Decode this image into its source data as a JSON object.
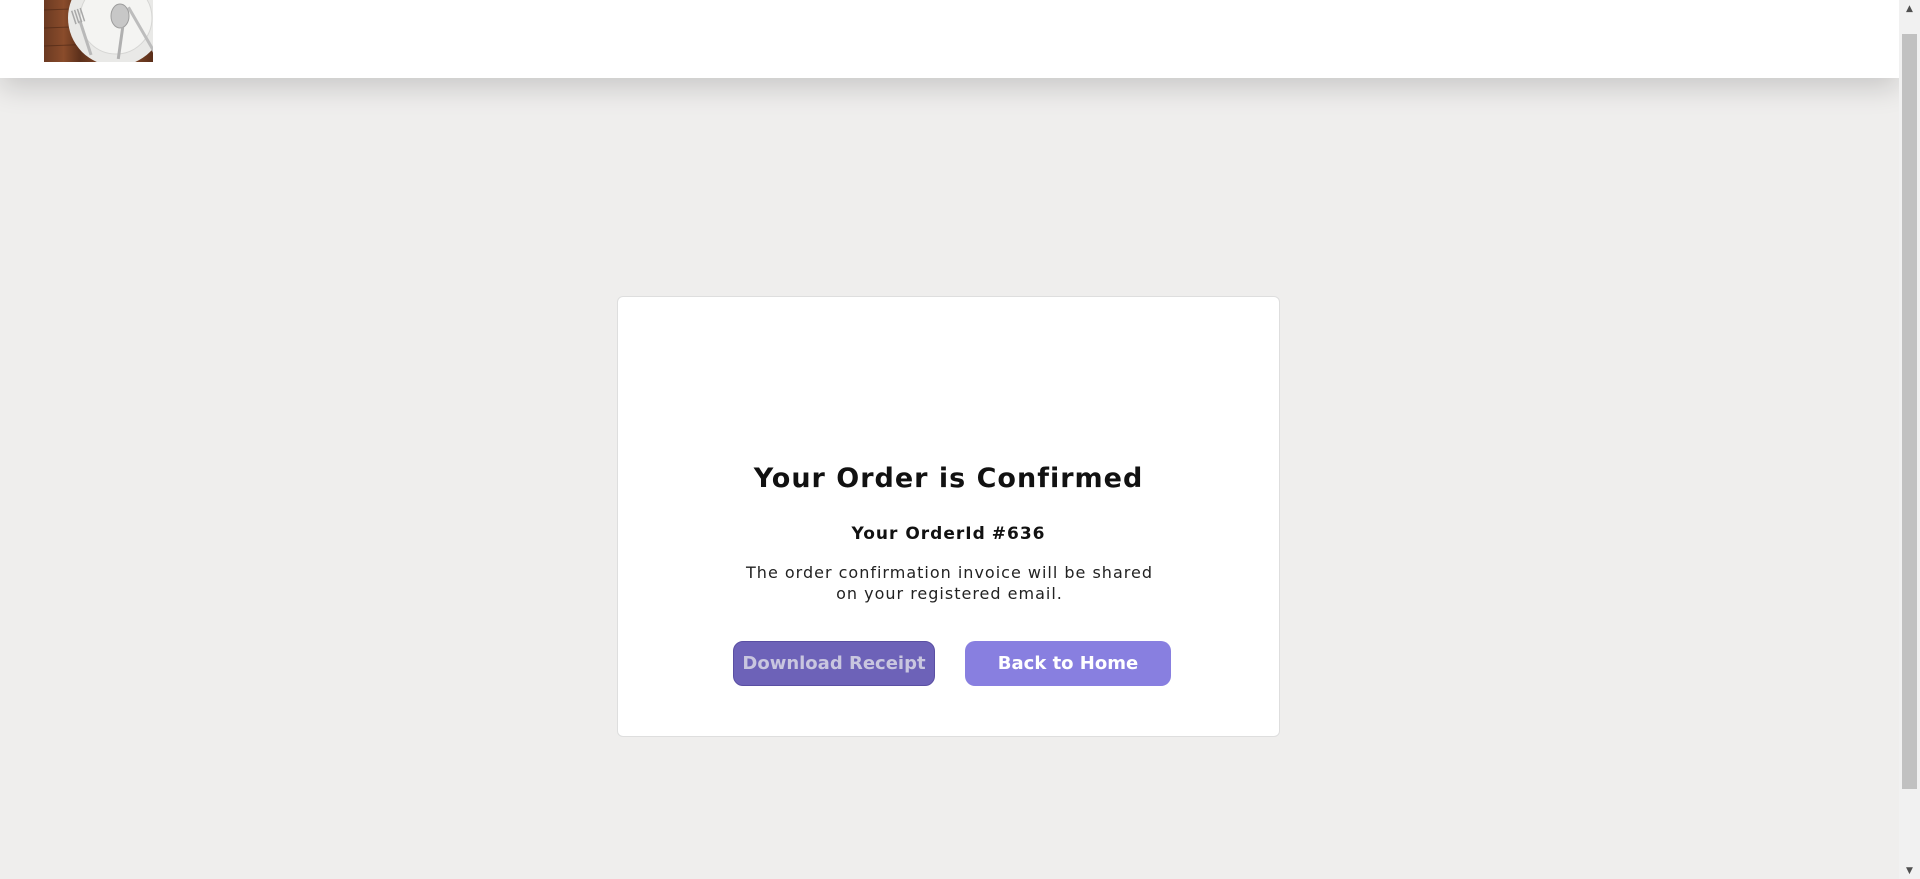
{
  "header": {
    "logo": "restaurant-logo"
  },
  "confirmation": {
    "title": "Your Order is Confirmed",
    "order_id_label": "Your OrderId",
    "order_id_value": "#636",
    "message": "The order confirmation invoice will be shared on your registered email."
  },
  "actions": {
    "download_label": "Download Receipt",
    "home_label": "Back to Home"
  },
  "scrollbar": {
    "up_icon": "chevron-up-icon",
    "down_icon": "chevron-down-icon"
  },
  "colors": {
    "page_background": "#efeeed",
    "download_button": "#6d62b8",
    "home_button": "#887fe0"
  }
}
